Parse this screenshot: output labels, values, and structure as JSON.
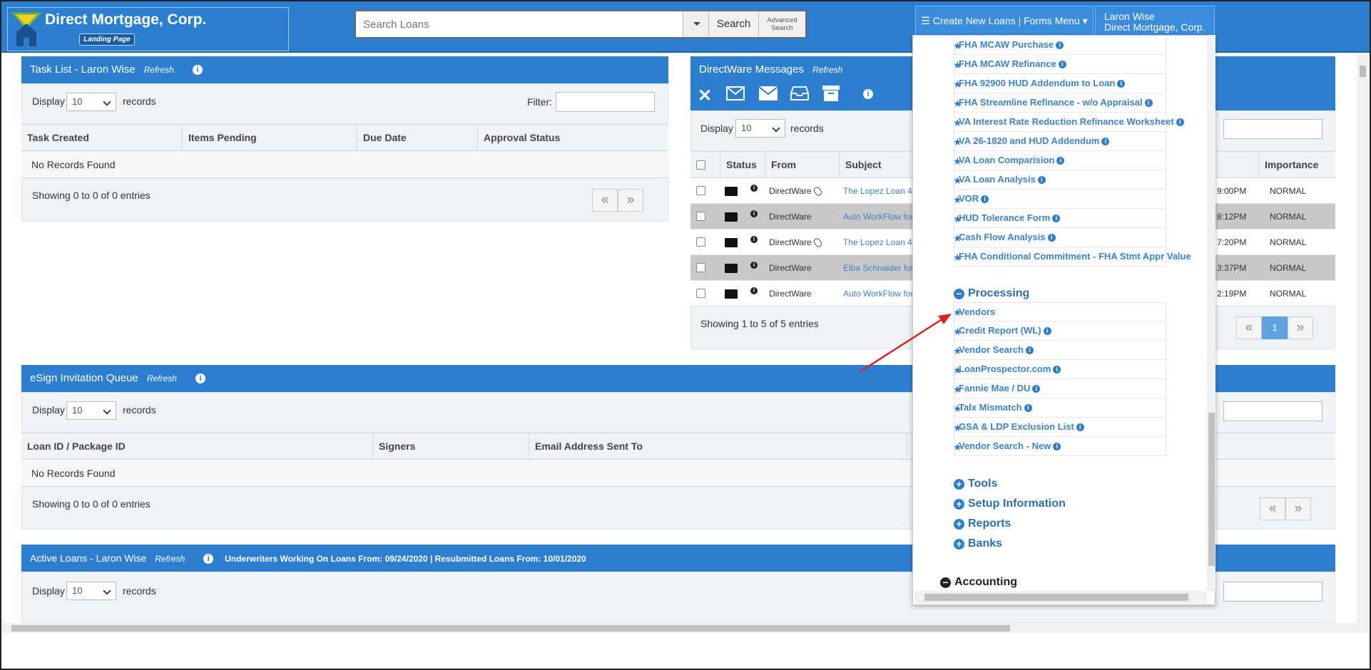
{
  "header": {
    "company_name": "Direct Mortgage, Corp.",
    "landing_label": "Landing Page",
    "search_placeholder": "Search Loans",
    "search_button": "Search",
    "advanced_search": "Advanced Search",
    "create_menu": "Create New Loans | Forms Menu",
    "user_name": "Laron Wise",
    "user_company": "Direct Mortgage, Corp."
  },
  "task_list": {
    "title": "Task List - Laron Wise",
    "refresh": "Refresh",
    "display_label": "Display",
    "display_value": "10",
    "records_label": "records",
    "filter_label": "Filter:",
    "columns": [
      "Task Created",
      "Items Pending",
      "Due Date",
      "Approval Status"
    ],
    "empty": "No Records Found",
    "showing": "Showing 0 to 0 of 0 entries"
  },
  "messages": {
    "title": "DirectWare Messages",
    "refresh": "Refresh",
    "display_label": "Display",
    "display_value": "10",
    "records_label": "records",
    "columns": [
      "Status",
      "From",
      "Subject",
      "Importance"
    ],
    "rows": [
      {
        "from": "DirectWare",
        "subject": "The Lopez Loan 4",
        "time": "9:00PM",
        "importance": "NORMAL"
      },
      {
        "from": "DirectWare",
        "subject": "Auto WorkFlow for",
        "time": "8:12PM",
        "importance": "NORMAL"
      },
      {
        "from": "DirectWare",
        "subject": "The Lopez Loan 4",
        "time": "7:20PM",
        "importance": "NORMAL"
      },
      {
        "from": "DirectWare",
        "subject": "Elba Schnaider for",
        "time": "3:37PM",
        "importance": "NORMAL"
      },
      {
        "from": "DirectWare",
        "subject": "Auto WorkFlow for",
        "time": "2:19PM",
        "importance": "NORMAL"
      }
    ],
    "showing": "Showing 1 to 5 of 5 entries",
    "current_page": "1"
  },
  "esign": {
    "title": "eSign Invitation Queue",
    "refresh": "Refresh",
    "display_label": "Display",
    "display_value": "10",
    "records_label": "records",
    "columns": [
      "Loan ID / Package ID",
      "Signers",
      "Email Address Sent To"
    ],
    "empty": "No Records Found",
    "showing": "Showing 0 to 0 of 0 entries"
  },
  "active_loans": {
    "title": "Active Loans - Laron Wise",
    "refresh": "Refresh",
    "notice": "Underwriters Working On Loans From: 09/24/2020 | Resubmitted Loans From: 10/01/2020",
    "display_label": "Display",
    "display_value": "10",
    "records_label": "records"
  },
  "forms_menu": {
    "items_top": [
      "FHA MCAW Purchase",
      "FHA MCAW Refinance",
      "FHA 92900 HUD Addendum to Loan",
      "FHA Streamline Refinance - w/o Appraisal",
      "VA Interest Rate Reduction Refinance Worksheet",
      "VA 26-1820 and HUD Addendum",
      "VA Loan Comparision",
      "VA Loan Analysis",
      "VOR",
      "HUD Tolerance Form",
      "Cash Flow Analysis",
      "FHA Conditional Commitment - FHA Stmt Appr Value"
    ],
    "processing_label": "Processing",
    "processing_items": [
      "Vendors",
      "Credit Report (WL)",
      "Vendor Search",
      "LoanProspector.com",
      "Fannie Mae / DU",
      "Talx Mismatch",
      "GSA & LDP Exclusion List",
      "Vendor Search - New"
    ],
    "sections": [
      "Tools",
      "Setup Information",
      "Reports",
      "Banks"
    ],
    "accounting_label": "Accounting"
  },
  "colors": {
    "primary": "#2c7fd0",
    "link": "#3b83c9",
    "annotation_arrow": "#e02020"
  }
}
